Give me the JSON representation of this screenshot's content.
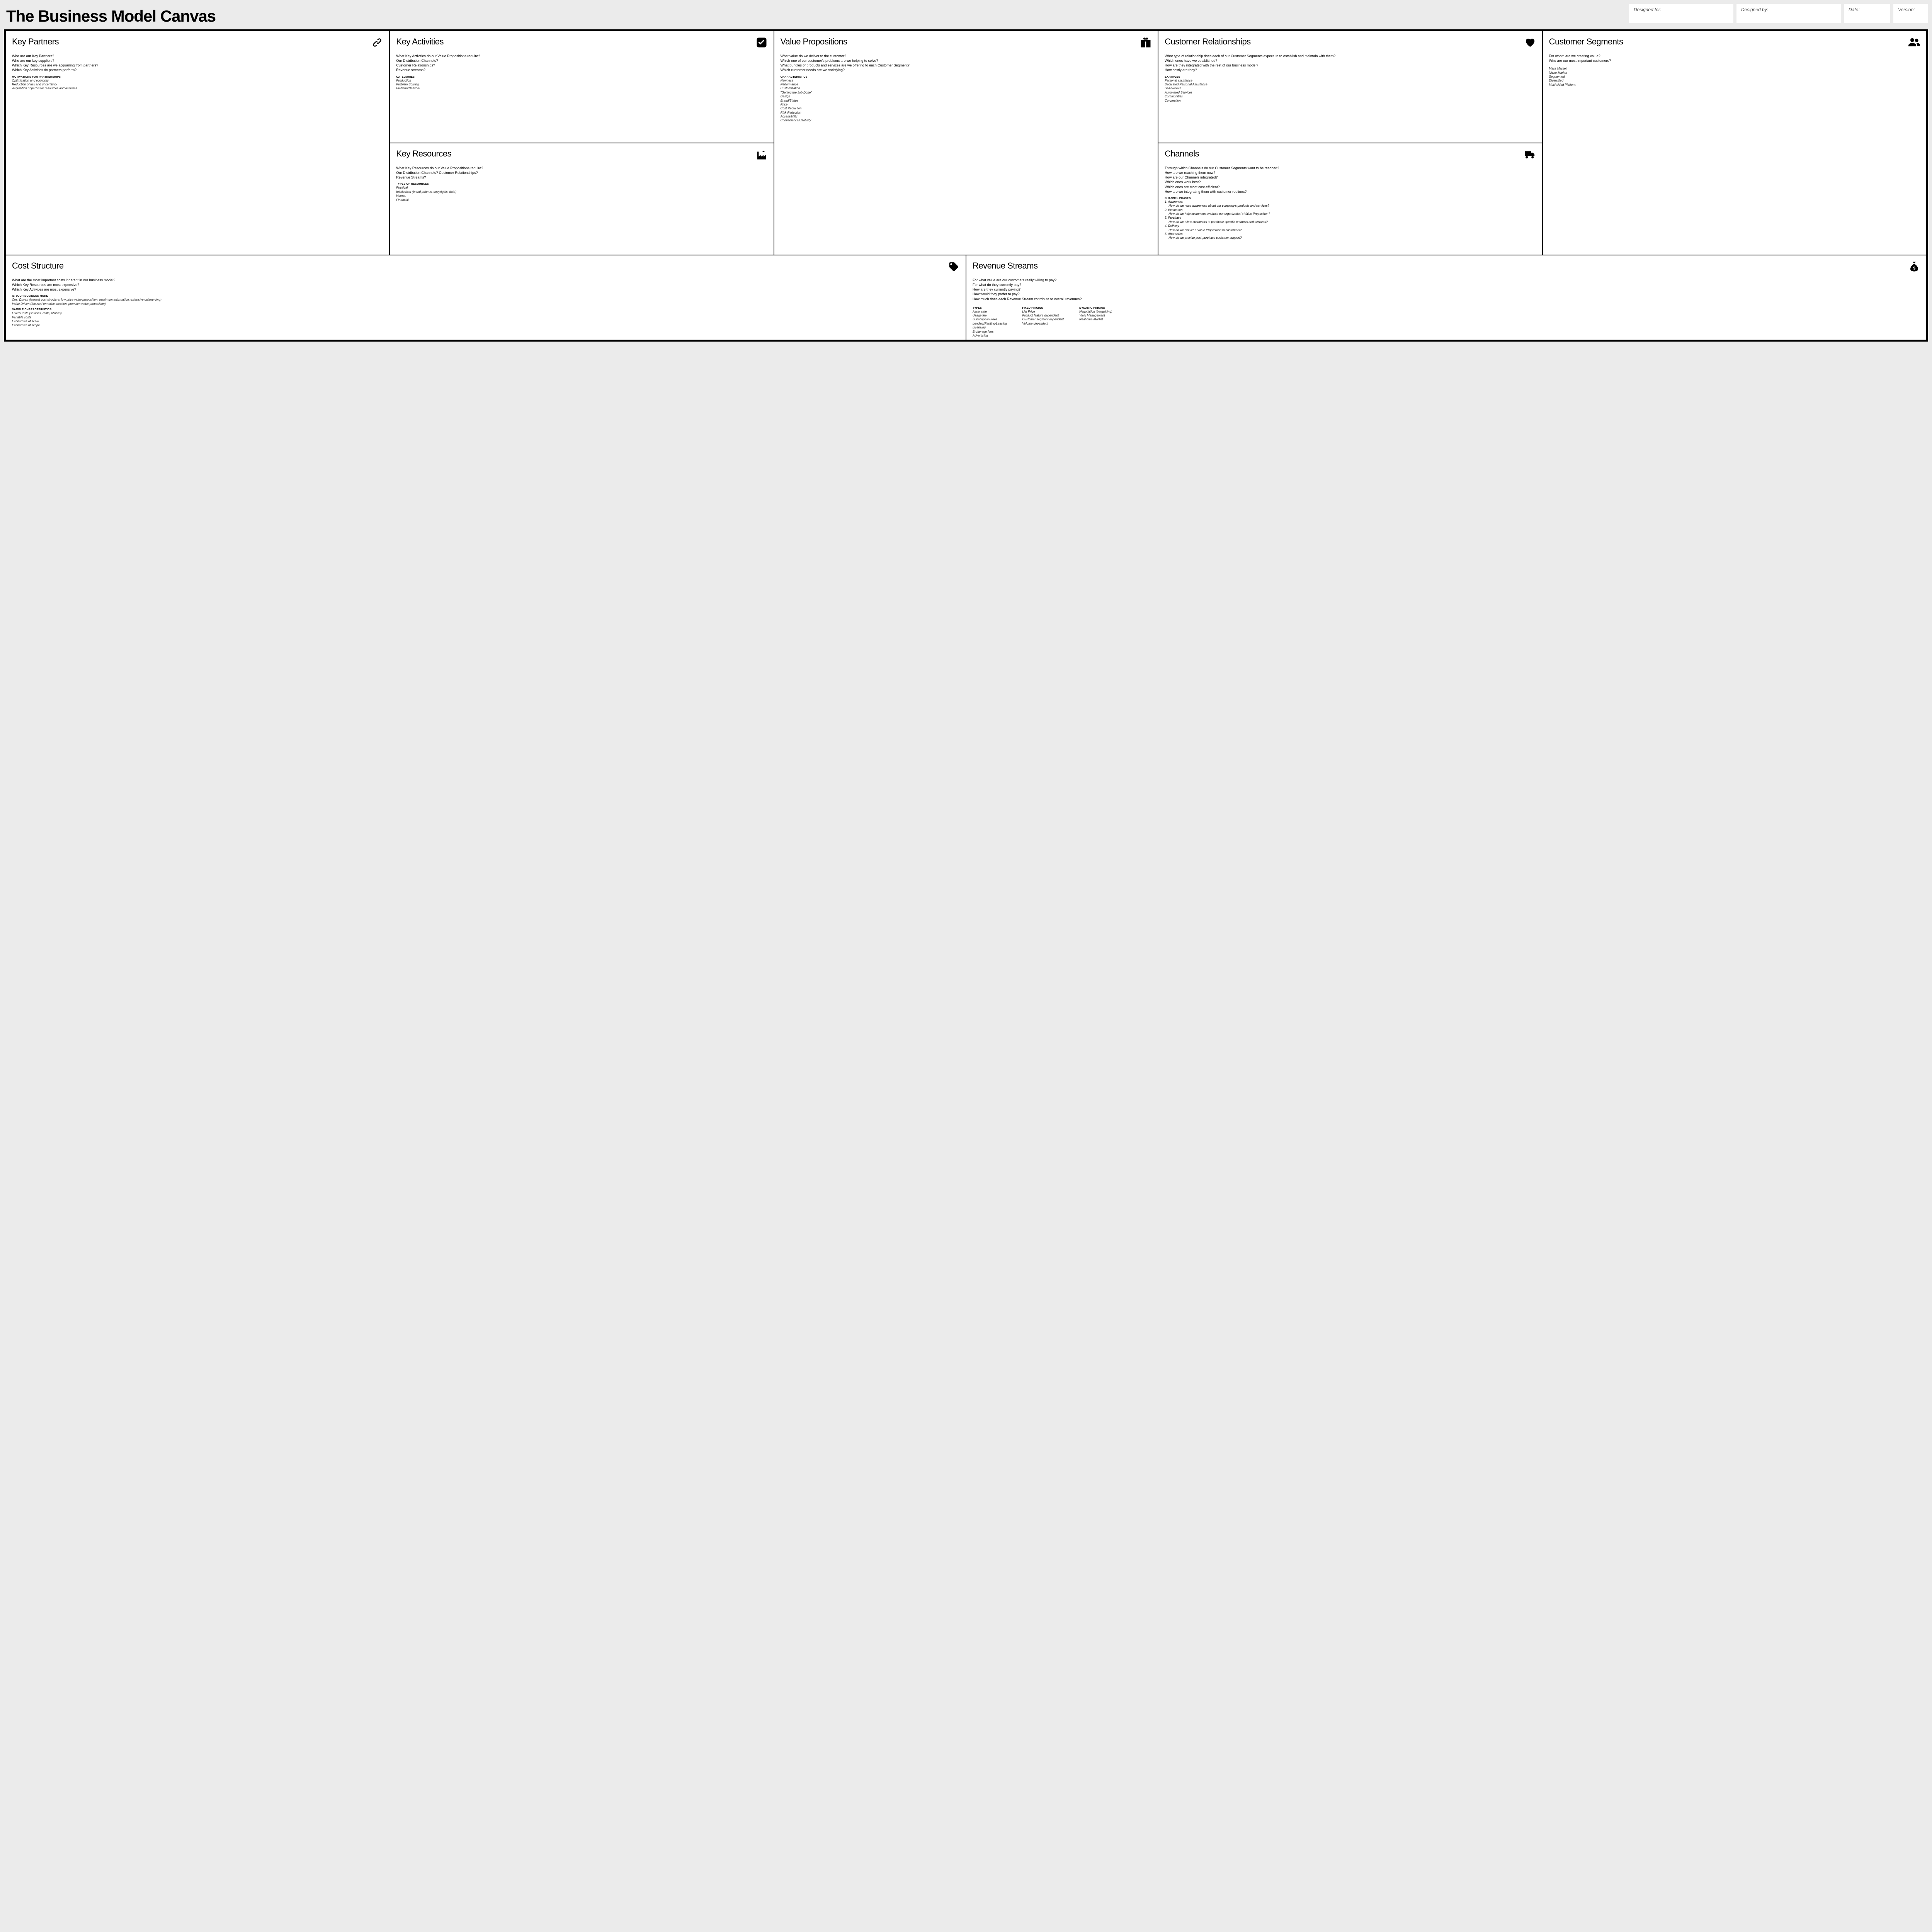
{
  "header": {
    "title": "The Business Model Canvas",
    "meta": {
      "designed_for": "Designed for:",
      "designed_by": "Designed by:",
      "date": "Date:",
      "version": "Version:"
    }
  },
  "blocks": {
    "key_partners": {
      "title": "Key Partners",
      "questions": [
        "Who are our Key Partners?",
        "Who are our key suppliers?",
        "Which Key Resources are we acquairing from partners?",
        "Which Key Activities do partners perform?"
      ],
      "subhead": "Motivations for partnerships",
      "items": [
        "Optimization and economy",
        "Reduction of risk and uncertainty",
        "Acquisition of particular resources and activities"
      ]
    },
    "key_activities": {
      "title": "Key Activities",
      "questions": [
        "What Key Activities do our Value Propositions require?",
        "Our Distribution Channels?",
        "Customer Relationships?",
        "Revenue streams?"
      ],
      "subhead": "Categories",
      "items": [
        "Production",
        "Problem Solving",
        "Platform/Network"
      ]
    },
    "key_resources": {
      "title": "Key Resources",
      "questions": [
        "What Key Resources do our Value Propositions require?",
        "Our Distribution Channels? Customer Relationships?",
        "Revenue Streams?"
      ],
      "subhead": "Types of resources",
      "items": [
        "Physical",
        "Intellectual (brand patents, copyrights, data)",
        "Human",
        "Financial"
      ]
    },
    "value_propositions": {
      "title": "Value Propositions",
      "questions": [
        "What value do we deliver to the customer?",
        "Which one of our customer's problems are we helping to solve?",
        "What bundles of products and services are we offering to each Customer Segment?",
        "Which customer needs are we satisfying?"
      ],
      "subhead": "Characteristics",
      "items": [
        "Newness",
        "Performance",
        "Customization",
        "\"Getting the Job Done\"",
        "Design",
        "Brand/Status",
        "Price",
        "Cost Reduction",
        "Risk Reduction",
        "Accessibility",
        "Convenience/Usability"
      ]
    },
    "customer_relationships": {
      "title": "Customer Relationships",
      "questions": [
        "What type of relationship does each of our Customer Segments expect us to establish and maintain with them?",
        "Which ones have we established?",
        "How are they integrated with the rest of our business model?",
        "How costly are they?"
      ],
      "subhead": "Examples",
      "items": [
        "Personal assistance",
        "Dedicated Personal Assistance",
        "Self-Service",
        "Automated Services",
        "Communities",
        "Co-creation"
      ]
    },
    "channels": {
      "title": "Channels",
      "questions": [
        "Through which Channels do our Customer Segments want to be reached?",
        "How are we reaching them now?",
        "How are our Channels integrated?",
        "Which ones work best?",
        "Which ones are most cost-efficient?",
        "How are we integrating them with customer routines?"
      ],
      "subhead": "Channel phases",
      "phases": [
        {
          "n": "1",
          "name": "Awareness",
          "q": "How do we raise awareness about our company's products and services?"
        },
        {
          "n": "2",
          "name": "Evaluation",
          "q": "How do we help customers evaluate our organization's Value Proposition?"
        },
        {
          "n": "3",
          "name": "Purchase",
          "q": "How do we allow customers to purchase specific products and services?"
        },
        {
          "n": "4",
          "name": "Delivery",
          "q": "How do we deliver a Value Proposition to customers?"
        },
        {
          "n": "5",
          "name": "After sales",
          "q": "How do we provide post-purchase customer support?"
        }
      ]
    },
    "customer_segments": {
      "title": "Customer Segments",
      "questions": [
        "For whom are we creating value?",
        "Who are our most important customers?"
      ],
      "items": [
        "Mass Market",
        "Niche Market",
        "Segmented",
        "Diversified",
        "Multi-sided Platform"
      ]
    },
    "cost_structure": {
      "title": "Cost Structure",
      "questions": [
        "What are the most important costs inherent in our business model?",
        "Which Key Resources are most expensive?",
        "Which Key Activities are most expensive?"
      ],
      "sub1": "Is your business more",
      "items1": [
        "Cost Driven (leanest cost structure, low price value proposition, maximum automation, extensive outsourcing)",
        "Value Driven (focused on value creation, premium value proposition)"
      ],
      "sub2": "Sample characteristics",
      "items2": [
        "Fixed Costs (salaries, rents, utilities)",
        "Variable costs",
        "Economies of scale",
        "Economies of scope"
      ]
    },
    "revenue_streams": {
      "title": "Revenue Streams",
      "questions": [
        "For what value are our customers really willing to pay?",
        "For what do they currently pay?",
        "How are they currently paying?",
        "How would they prefer to pay?",
        "How much does each Revenue Stream contribute to overall revenues?"
      ],
      "col1_head": "Types",
      "col1": [
        "Asset sale",
        "Usage fee",
        "Subscription Fees",
        "Lending/Renting/Leasing",
        "Licensing",
        "Brokerage fees",
        "Advertising"
      ],
      "col2_head": "Fixed pricing",
      "col2": [
        "List Price",
        "Product feature dependent",
        "Customer segment dependent",
        "Volume dependent"
      ],
      "col3_head": "Dynamic pricing",
      "col3": [
        "Negotiation (bargaining)",
        "Yield Management",
        "Real-time-Market"
      ]
    }
  }
}
